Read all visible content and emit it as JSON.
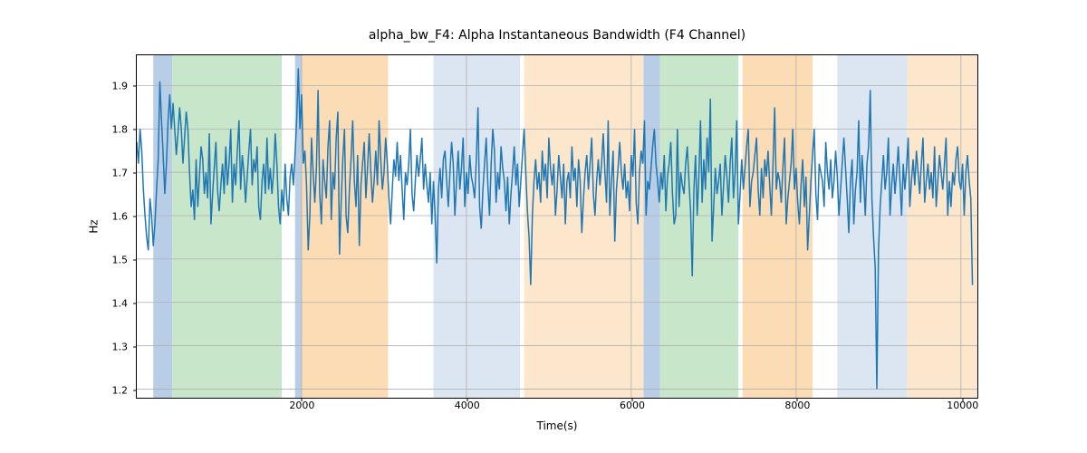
{
  "chart_data": {
    "type": "line",
    "title": "alpha_bw_F4: Alpha Instantaneous Bandwidth (F4 Channel)",
    "xlabel": "Time(s)",
    "ylabel": "Hz",
    "xlim": [
      0,
      10200
    ],
    "ylim": [
      1.18,
      1.97
    ],
    "xticks": [
      2000,
      4000,
      6000,
      8000,
      10000
    ],
    "yticks": [
      1.2,
      1.3,
      1.4,
      1.5,
      1.6,
      1.7,
      1.8,
      1.9
    ],
    "grid": true,
    "line_color": "#1f77b4",
    "background_regions": [
      {
        "x0": 200,
        "x1": 430,
        "color": "#b8cee6"
      },
      {
        "x0": 430,
        "x1": 1760,
        "color": "#c8e6c9"
      },
      {
        "x0": 1920,
        "x1": 2000,
        "color": "#b8cee6"
      },
      {
        "x0": 2000,
        "x1": 3050,
        "color": "#fcdcb5"
      },
      {
        "x0": 3600,
        "x1": 4650,
        "color": "#dbe6f2"
      },
      {
        "x0": 4700,
        "x1": 6150,
        "color": "#fde7cc"
      },
      {
        "x0": 6150,
        "x1": 6350,
        "color": "#b8cee6"
      },
      {
        "x0": 6350,
        "x1": 7300,
        "color": "#c8e6c9"
      },
      {
        "x0": 7350,
        "x1": 8200,
        "color": "#fcdcb5"
      },
      {
        "x0": 8500,
        "x1": 9350,
        "color": "#dbe6f2"
      },
      {
        "x0": 9350,
        "x1": 10200,
        "color": "#fde7cc"
      }
    ],
    "series": {
      "name": "alpha_bw_F4",
      "x_start": 0,
      "x_step": 20,
      "values_summary": "Noisy EEG bandwidth signal, ~500 samples over 0–10200 s. Mean ≈ 1.68 Hz, typical range 1.50–1.85, occasional dips to ~1.44 and one deep dip to ~1.20 near t≈9000. Early segment (200–450 s) briefly peaks ~1.91; segment near t≈2000 has global max ≈1.94.",
      "y": [
        1.77,
        1.72,
        1.8,
        1.75,
        1.66,
        1.6,
        1.55,
        1.52,
        1.64,
        1.6,
        1.53,
        1.58,
        1.66,
        1.73,
        1.91,
        1.82,
        1.74,
        1.65,
        1.72,
        1.82,
        1.88,
        1.8,
        1.86,
        1.8,
        1.74,
        1.79,
        1.85,
        1.8,
        1.72,
        1.78,
        1.84,
        1.8,
        1.7,
        1.62,
        1.66,
        1.59,
        1.73,
        1.62,
        1.69,
        1.76,
        1.73,
        1.65,
        1.7,
        1.64,
        1.79,
        1.58,
        1.65,
        1.71,
        1.77,
        1.66,
        1.61,
        1.67,
        1.72,
        1.65,
        1.76,
        1.67,
        1.72,
        1.8,
        1.63,
        1.72,
        1.67,
        1.75,
        1.82,
        1.66,
        1.74,
        1.7,
        1.63,
        1.69,
        1.75,
        1.8,
        1.67,
        1.73,
        1.7,
        1.76,
        1.62,
        1.59,
        1.68,
        1.72,
        1.65,
        1.78,
        1.66,
        1.71,
        1.65,
        1.7,
        1.79,
        1.72,
        1.62,
        1.58,
        1.66,
        1.61,
        1.72,
        1.64,
        1.6,
        1.69,
        1.72,
        1.67,
        1.74,
        1.82,
        1.94,
        1.8,
        1.88,
        1.72,
        1.75,
        1.67,
        1.52,
        1.6,
        1.78,
        1.7,
        1.63,
        1.71,
        1.89,
        1.65,
        1.58,
        1.73,
        1.68,
        1.64,
        1.76,
        1.82,
        1.59,
        1.7,
        1.66,
        1.78,
        1.84,
        1.51,
        1.63,
        1.73,
        1.8,
        1.6,
        1.56,
        1.66,
        1.73,
        1.82,
        1.68,
        1.62,
        1.74,
        1.53,
        1.67,
        1.72,
        1.77,
        1.64,
        1.71,
        1.79,
        1.7,
        1.63,
        1.68,
        1.75,
        1.67,
        1.82,
        1.73,
        1.66,
        1.7,
        1.78,
        1.72,
        1.64,
        1.58,
        1.66,
        1.73,
        1.69,
        1.77,
        1.68,
        1.74,
        1.66,
        1.59,
        1.7,
        1.67,
        1.72,
        1.8,
        1.65,
        1.61,
        1.68,
        1.74,
        1.69,
        1.73,
        1.78,
        1.66,
        1.72,
        1.67,
        1.63,
        1.7,
        1.58,
        1.68,
        1.6,
        1.49,
        1.66,
        1.71,
        1.64,
        1.73,
        1.75,
        1.68,
        1.62,
        1.7,
        1.77,
        1.72,
        1.6,
        1.68,
        1.75,
        1.66,
        1.71,
        1.78,
        1.62,
        1.7,
        1.65,
        1.74,
        1.69,
        1.67,
        1.64,
        1.73,
        1.85,
        1.62,
        1.57,
        1.66,
        1.72,
        1.78,
        1.67,
        1.6,
        1.72,
        1.8,
        1.75,
        1.63,
        1.7,
        1.66,
        1.76,
        1.71,
        1.68,
        1.61,
        1.69,
        1.58,
        1.65,
        1.7,
        1.76,
        1.67,
        1.72,
        1.62,
        1.68,
        1.74,
        1.8,
        1.7,
        1.61,
        1.55,
        1.44,
        1.6,
        1.68,
        1.73,
        1.66,
        1.7,
        1.63,
        1.75,
        1.68,
        1.72,
        1.64,
        1.78,
        1.71,
        1.67,
        1.72,
        1.6,
        1.66,
        1.74,
        1.69,
        1.64,
        1.72,
        1.58,
        1.68,
        1.7,
        1.64,
        1.76,
        1.68,
        1.71,
        1.62,
        1.73,
        1.68,
        1.56,
        1.64,
        1.7,
        1.74,
        1.66,
        1.72,
        1.78,
        1.65,
        1.6,
        1.68,
        1.73,
        1.67,
        1.72,
        1.79,
        1.7,
        1.63,
        1.82,
        1.6,
        1.68,
        1.75,
        1.54,
        1.66,
        1.71,
        1.77,
        1.7,
        1.66,
        1.72,
        1.64,
        1.68,
        1.61,
        1.74,
        1.69,
        1.8,
        1.63,
        1.58,
        1.7,
        1.75,
        1.72,
        1.82,
        1.6,
        1.68,
        1.66,
        1.71,
        1.76,
        1.8,
        1.72,
        1.68,
        1.63,
        1.7,
        1.66,
        1.74,
        1.61,
        1.69,
        1.72,
        1.77,
        1.65,
        1.58,
        1.6,
        1.8,
        1.62,
        1.7,
        1.67,
        1.65,
        1.72,
        1.76,
        1.68,
        1.61,
        1.46,
        1.66,
        1.74,
        1.6,
        1.69,
        1.82,
        1.63,
        1.73,
        1.66,
        1.78,
        1.7,
        1.87,
        1.54,
        1.62,
        1.71,
        1.65,
        1.68,
        1.72,
        1.6,
        1.67,
        1.74,
        1.69,
        1.63,
        1.72,
        1.78,
        1.64,
        1.7,
        1.82,
        1.58,
        1.65,
        1.73,
        1.66,
        1.71,
        1.76,
        1.8,
        1.62,
        1.68,
        1.7,
        1.74,
        1.78,
        1.66,
        1.6,
        1.71,
        1.64,
        1.73,
        1.69,
        1.75,
        1.67,
        1.6,
        1.72,
        1.85,
        1.66,
        1.7,
        1.68,
        1.63,
        1.71,
        1.78,
        1.58,
        1.64,
        1.68,
        1.72,
        1.8,
        1.66,
        1.71,
        1.63,
        1.58,
        1.67,
        1.73,
        1.62,
        1.69,
        1.52,
        1.6,
        1.68,
        1.74,
        1.8,
        1.65,
        1.59,
        1.72,
        1.7,
        1.68,
        1.62,
        1.77,
        1.7,
        1.66,
        1.73,
        1.64,
        1.68,
        1.75,
        1.69,
        1.6,
        1.66,
        1.72,
        1.78,
        1.71,
        1.64,
        1.56,
        1.68,
        1.73,
        1.58,
        1.66,
        1.7,
        1.82,
        1.63,
        1.74,
        1.68,
        1.6,
        1.72,
        1.76,
        1.89,
        1.64,
        1.55,
        1.48,
        1.2,
        1.52,
        1.62,
        1.68,
        1.74,
        1.66,
        1.7,
        1.78,
        1.6,
        1.67,
        1.72,
        1.65,
        1.7,
        1.76,
        1.68,
        1.6,
        1.72,
        1.66,
        1.71,
        1.78,
        1.62,
        1.68,
        1.73,
        1.67,
        1.75,
        1.7,
        1.65,
        1.72,
        1.78,
        1.63,
        1.68,
        1.72,
        1.66,
        1.7,
        1.64,
        1.76,
        1.62,
        1.68,
        1.74,
        1.7,
        1.66,
        1.72,
        1.78,
        1.6,
        1.68,
        1.62,
        1.7,
        1.67,
        1.73,
        1.76,
        1.68,
        1.66,
        1.72,
        1.6,
        1.7,
        1.74,
        1.68,
        1.64,
        1.44
      ]
    }
  }
}
